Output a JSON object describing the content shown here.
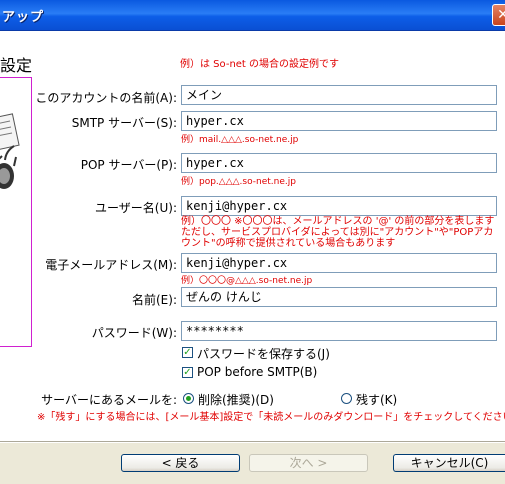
{
  "window": {
    "title": "アップ"
  },
  "heading": "設定",
  "note_top": "例）は So-net の場合の設定例です",
  "fields": {
    "account_name": {
      "label": "このアカウントの名前(A):",
      "value": "メイン"
    },
    "smtp": {
      "label": "SMTP サーバー(S):",
      "value": "hyper.cx",
      "example": "例）mail.△△△.so-net.ne.jp"
    },
    "pop": {
      "label": "POP サーバー(P):",
      "value": "hyper.cx",
      "example": "例）pop.△△△.so-net.ne.jp"
    },
    "user": {
      "label": "ユーザー名(U):",
      "value": "kenji@hyper.cx",
      "example_lines": [
        "例）〇〇〇 ※〇〇〇は、メールアドレスの '@' の前の部分を表します",
        "ただし、サービスプロバイダによっては別に\"アカウント\"や\"POPアカ",
        "ウント\"の呼称で提供されている場合もあります"
      ]
    },
    "email": {
      "label": "電子メールアドレス(M):",
      "value": "kenji@hyper.cx",
      "example": "例）〇〇〇@△△△.so-net.ne.jp"
    },
    "name": {
      "label": "名前(E):",
      "value": "ぜんの けんじ"
    },
    "password": {
      "label": "パスワード(W):",
      "value": "********"
    }
  },
  "checkboxes": {
    "save_password": {
      "label": "パスワードを保存する(J)",
      "checked": true
    },
    "pop_before_smtp": {
      "label": "POP before SMTP(B)",
      "checked": true
    }
  },
  "server_mail": {
    "label": "サーバーにあるメールを:",
    "delete": {
      "label": "削除(推奨)(D)",
      "selected": true
    },
    "keep": {
      "label": "残す(K)",
      "selected": false
    }
  },
  "note_bottom": "※「残す」にする場合には、[メール基本]設定で「未読メールのみダウンロード」をチェックしてください",
  "buttons": {
    "back": "< 戻る",
    "next": "次へ >",
    "cancel": "キャンセル(C)"
  },
  "colors": {
    "accent_red": "#e00000",
    "title_blue": "#0a59e0",
    "frame_magenta": "#d020d0"
  }
}
